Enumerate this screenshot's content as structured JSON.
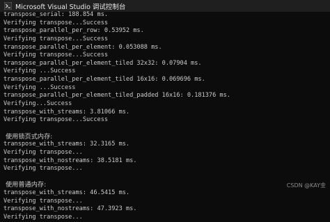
{
  "window": {
    "title": "Microsoft Visual Studio 调试控制台",
    "icon": "visual-studio-icon",
    "colors": {
      "background": "#0c0c0c",
      "titlebar": "#1f1f1f",
      "text": "#cccccc"
    }
  },
  "console": {
    "lines": [
      {
        "text": "transpose_serial: 188.854 ms."
      },
      {
        "text": "Verifying transpose...Success"
      },
      {
        "text": "transpose_parallel_per_row: 0.53952 ms."
      },
      {
        "text": "Verifying transpose...Success"
      },
      {
        "text": "transpose_parallel_per_element: 0.053088 ms."
      },
      {
        "text": "Verifying transpose...Success"
      },
      {
        "text": "transpose_parallel_per_element_tiled 32x32: 0.07904 ms."
      },
      {
        "text": "Verifying ...Success"
      },
      {
        "text": "transpose_parallel_per_element_tiled 16x16: 0.069696 ms."
      },
      {
        "text": "Verifying ...Success"
      },
      {
        "text": "transpose_parallel_per_element_tiled_padded 16x16: 0.181376 ms."
      },
      {
        "text": "Verifying...Success"
      },
      {
        "text": "transpose_with_streams: 3.81066 ms."
      },
      {
        "text": "Verifying transpose...Success"
      },
      {
        "text": ""
      },
      {
        "text": "使用锁页式内存:",
        "cn": true
      },
      {
        "text": "transpose_with_streams: 32.3165 ms."
      },
      {
        "text": "Verifying transpose..."
      },
      {
        "text": "transpose_with_nostreams: 38.5181 ms."
      },
      {
        "text": "Verifying transpose..."
      },
      {
        "text": ""
      },
      {
        "text": "使用普通内存:",
        "cn": true
      },
      {
        "text": "transpose_with_streams: 46.5415 ms."
      },
      {
        "text": "Verifying transpose..."
      },
      {
        "text": "transpose_with_nostreams: 47.3923 ms."
      },
      {
        "text": "Verifying transpose..."
      }
    ]
  },
  "watermark": "CSDN @KAY金"
}
